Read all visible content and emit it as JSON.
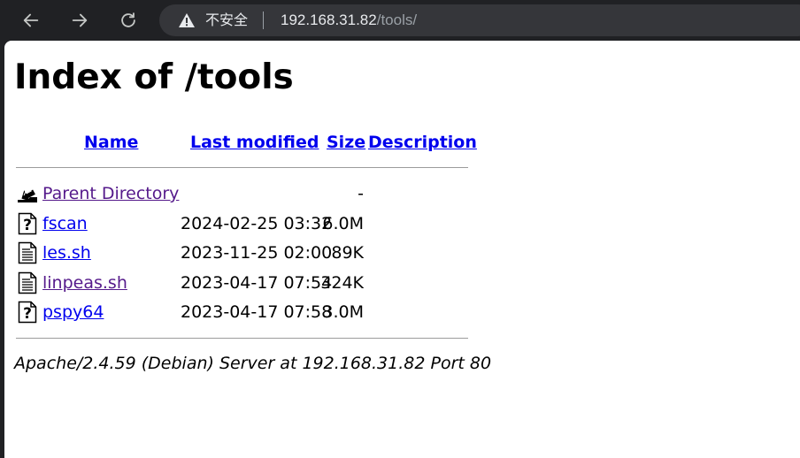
{
  "browser": {
    "security_label": "不安全",
    "url_host": "192.168.31.82",
    "url_path": "/tools/"
  },
  "page": {
    "title": "Index of /tools",
    "columns": {
      "name": "Name",
      "last_modified": "Last modified",
      "size": "Size",
      "description": "Description"
    },
    "parent": {
      "name": "Parent Directory",
      "size": "-"
    },
    "files": [
      {
        "name": "fscan",
        "modified": "2024-02-25 03:32",
        "size": "6.0M",
        "icon": "unknown-file-icon"
      },
      {
        "name": "les.sh",
        "modified": "2023-11-25 02:00",
        "size": "89K",
        "icon": "text-file-icon"
      },
      {
        "name": "linpeas.sh",
        "modified": "2023-04-17 07:54",
        "size": "324K",
        "icon": "text-file-icon"
      },
      {
        "name": "pspy64",
        "modified": "2023-04-17 07:58",
        "size": "3.0M",
        "icon": "unknown-file-icon"
      }
    ],
    "footer": "Apache/2.4.59 (Debian) Server at 192.168.31.82 Port 80"
  },
  "colors": {
    "link": "#0000ee",
    "visited_link": "#551a8b",
    "toolbar": "#202124",
    "omnibox": "#35363a"
  }
}
